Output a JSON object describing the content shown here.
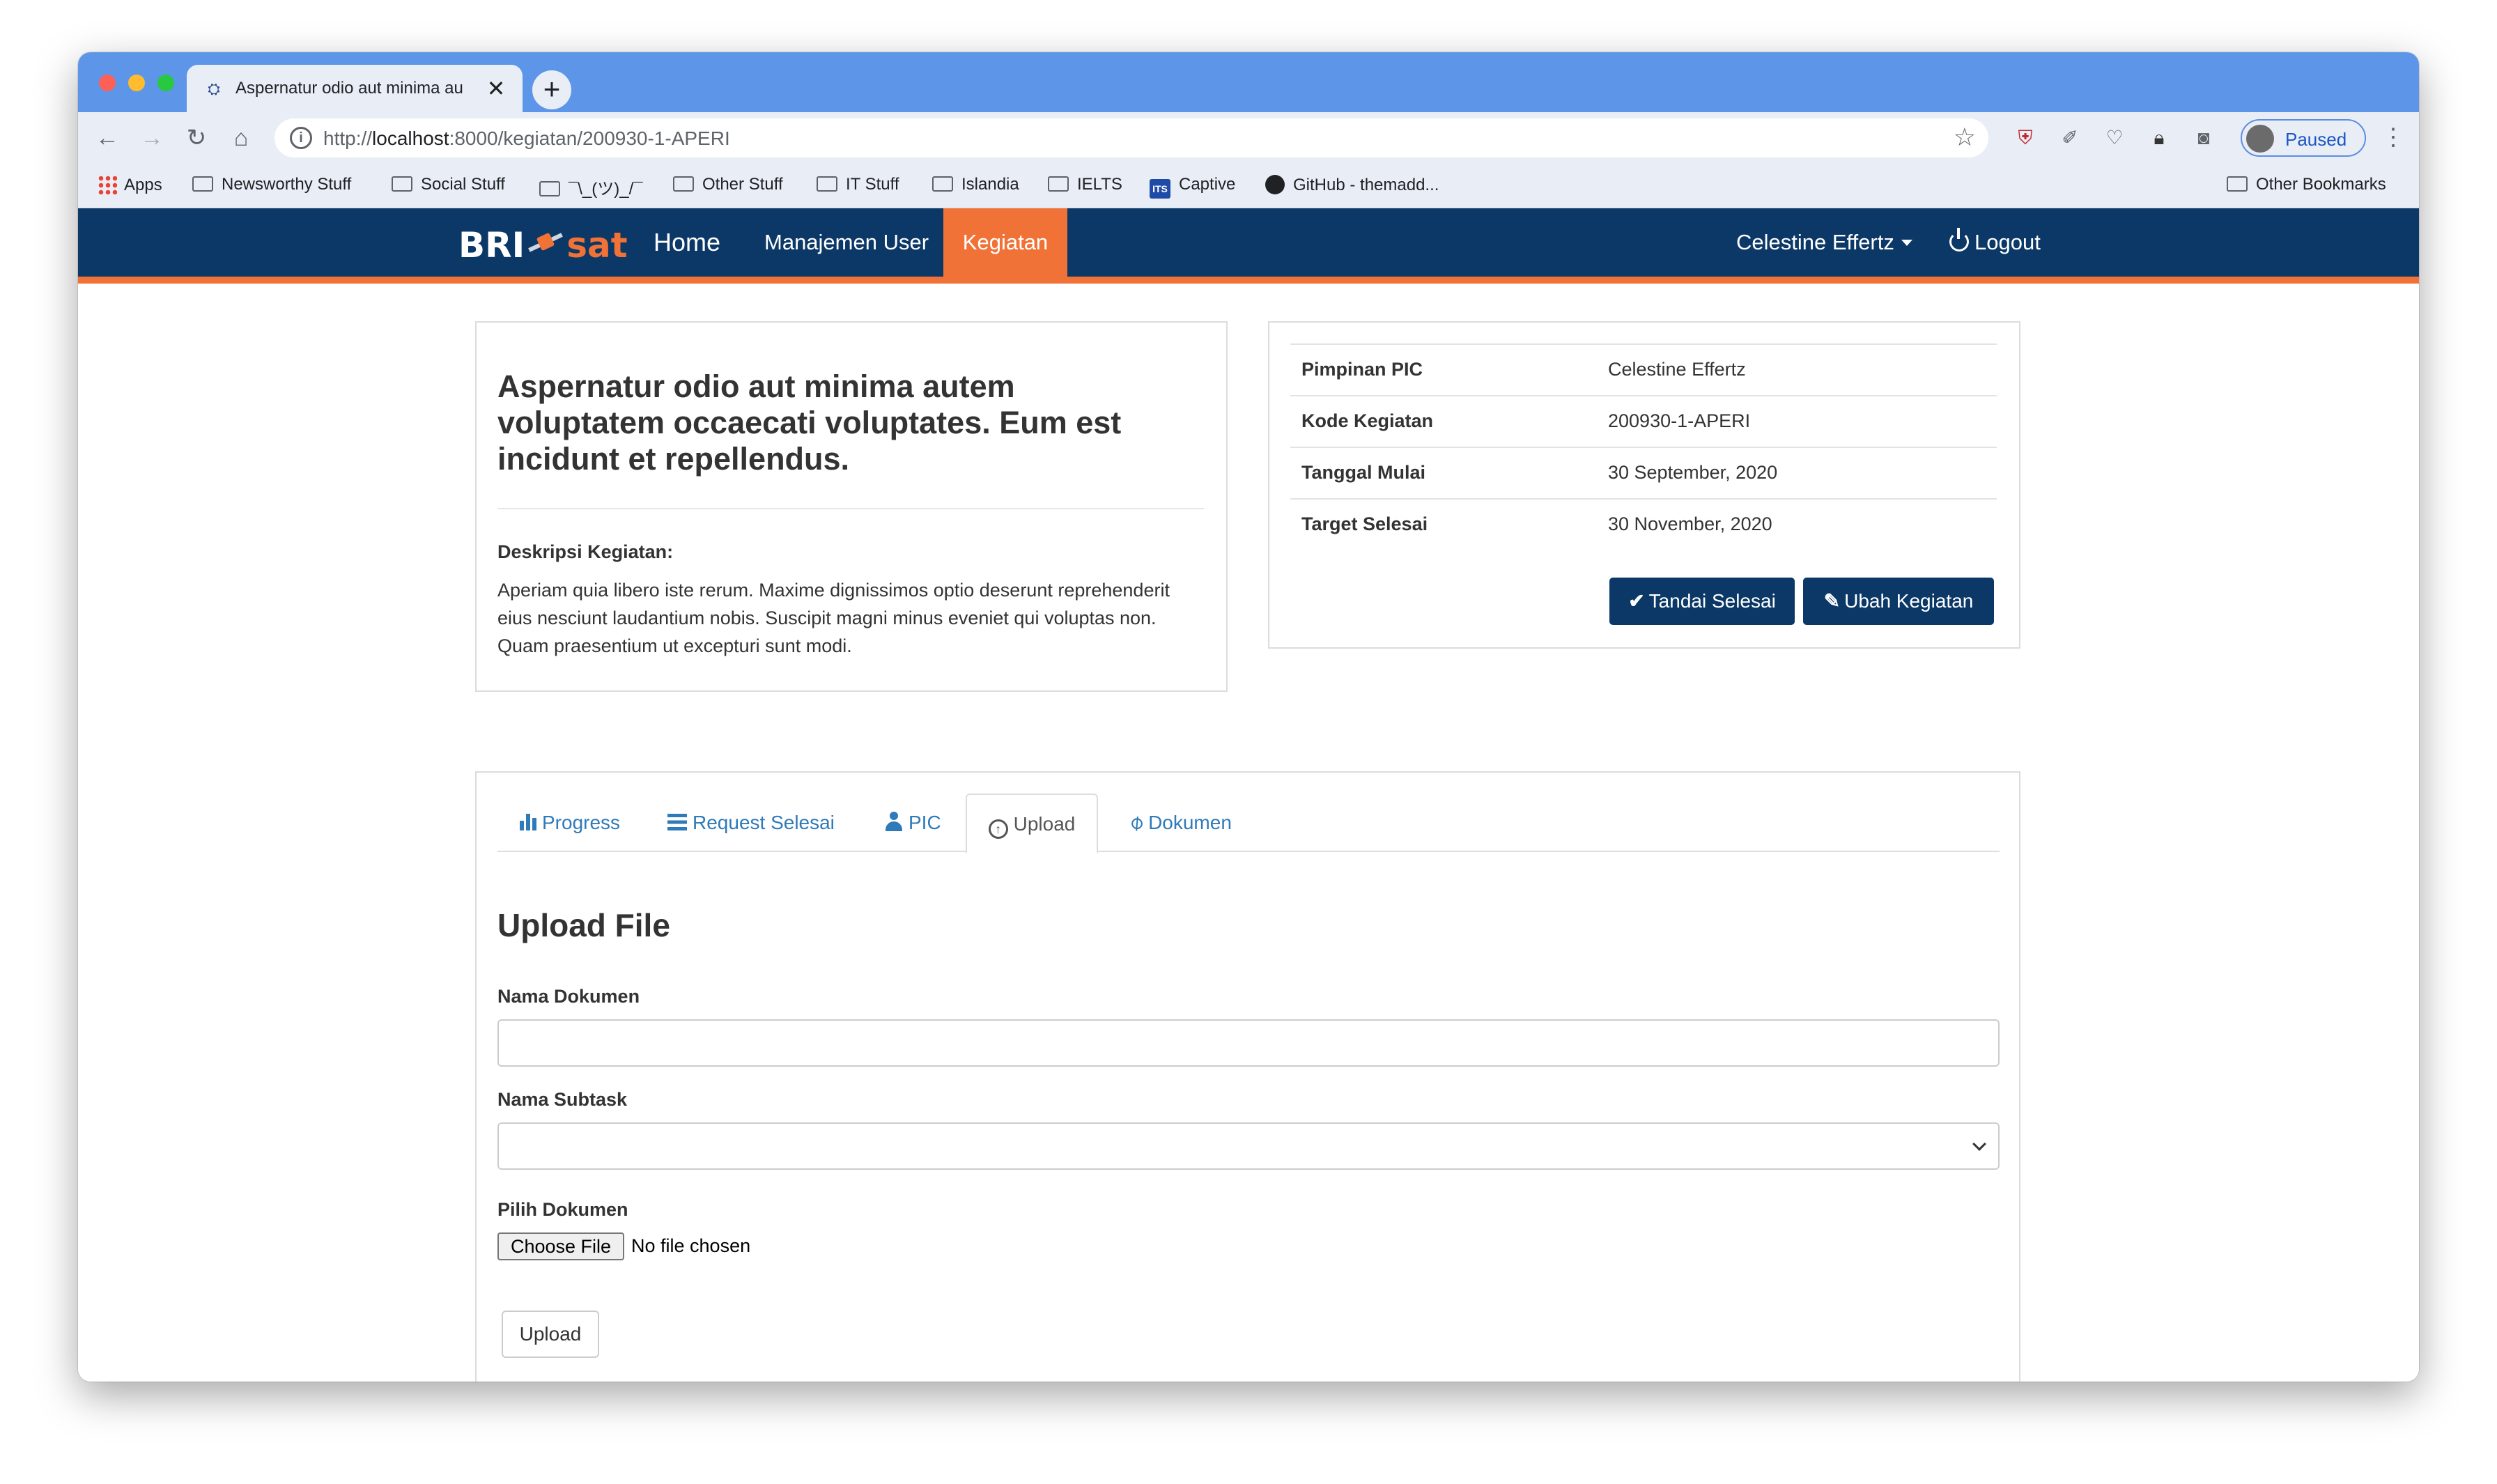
{
  "browser": {
    "tab_title": "Aspernatur odio aut minima au",
    "tab_close": "✕",
    "new_tab": "+",
    "url_prefix": "http://",
    "url_host": "localhost",
    "url_path": ":8000/kegiatan/200930-1-APERI",
    "profile_status": "Paused",
    "bookmarks": [
      "Apps",
      "Newsworthy Stuff",
      "Social Stuff",
      "¯\\_(ツ)_/¯",
      "Other Stuff",
      "IT Stuff",
      "Islandia",
      "IELTS",
      "Captive",
      "GitHub - themadd...",
      "Other Bookmarks"
    ],
    "its_badge": "ITS"
  },
  "navbar": {
    "brand_bri": "BRI",
    "brand_sat": "sat",
    "home": "Home",
    "user_management": "Manajemen User",
    "activities": "Kegiatan",
    "current_user": "Celestine Effertz",
    "logout": "Logout"
  },
  "activity": {
    "title": "Aspernatur odio aut minima autem voluptatem occaecati voluptates. Eum est incidunt et repellendus.",
    "description_label": "Deskripsi Kegiatan:",
    "description": "Aperiam quia libero iste rerum. Maxime dignissimos optio deserunt reprehenderit eius nesciunt laudantium nobis. Suscipit magni minus eveniet qui voluptas non. Quam praesentium ut excepturi sunt modi."
  },
  "info": [
    {
      "key": "Pimpinan PIC",
      "value": "Celestine Effertz"
    },
    {
      "key": "Kode Kegiatan",
      "value": "200930-1-APERI"
    },
    {
      "key": "Tanggal Mulai",
      "value": "30 September, 2020"
    },
    {
      "key": "Target Selesai",
      "value": "30 November, 2020"
    }
  ],
  "actions": {
    "mark_done": "Tandai Selesai",
    "edit": "Ubah Kegiatan"
  },
  "tabs": [
    "Progress",
    "Request Selesai",
    "PIC",
    "Upload",
    "Dokumen"
  ],
  "active_tab": "Upload",
  "upload_form": {
    "title": "Upload File",
    "doc_name_label": "Nama Dokumen",
    "doc_name_value": "",
    "subtask_label": "Nama Subtask",
    "subtask_value": "",
    "choose_label": "Pilih Dokumen",
    "choose_button": "Choose File",
    "file_status": "No file chosen",
    "submit": "Upload"
  },
  "colors": {
    "navbar": "#0b3866",
    "accent": "#f07236",
    "link": "#2f7ab8"
  }
}
